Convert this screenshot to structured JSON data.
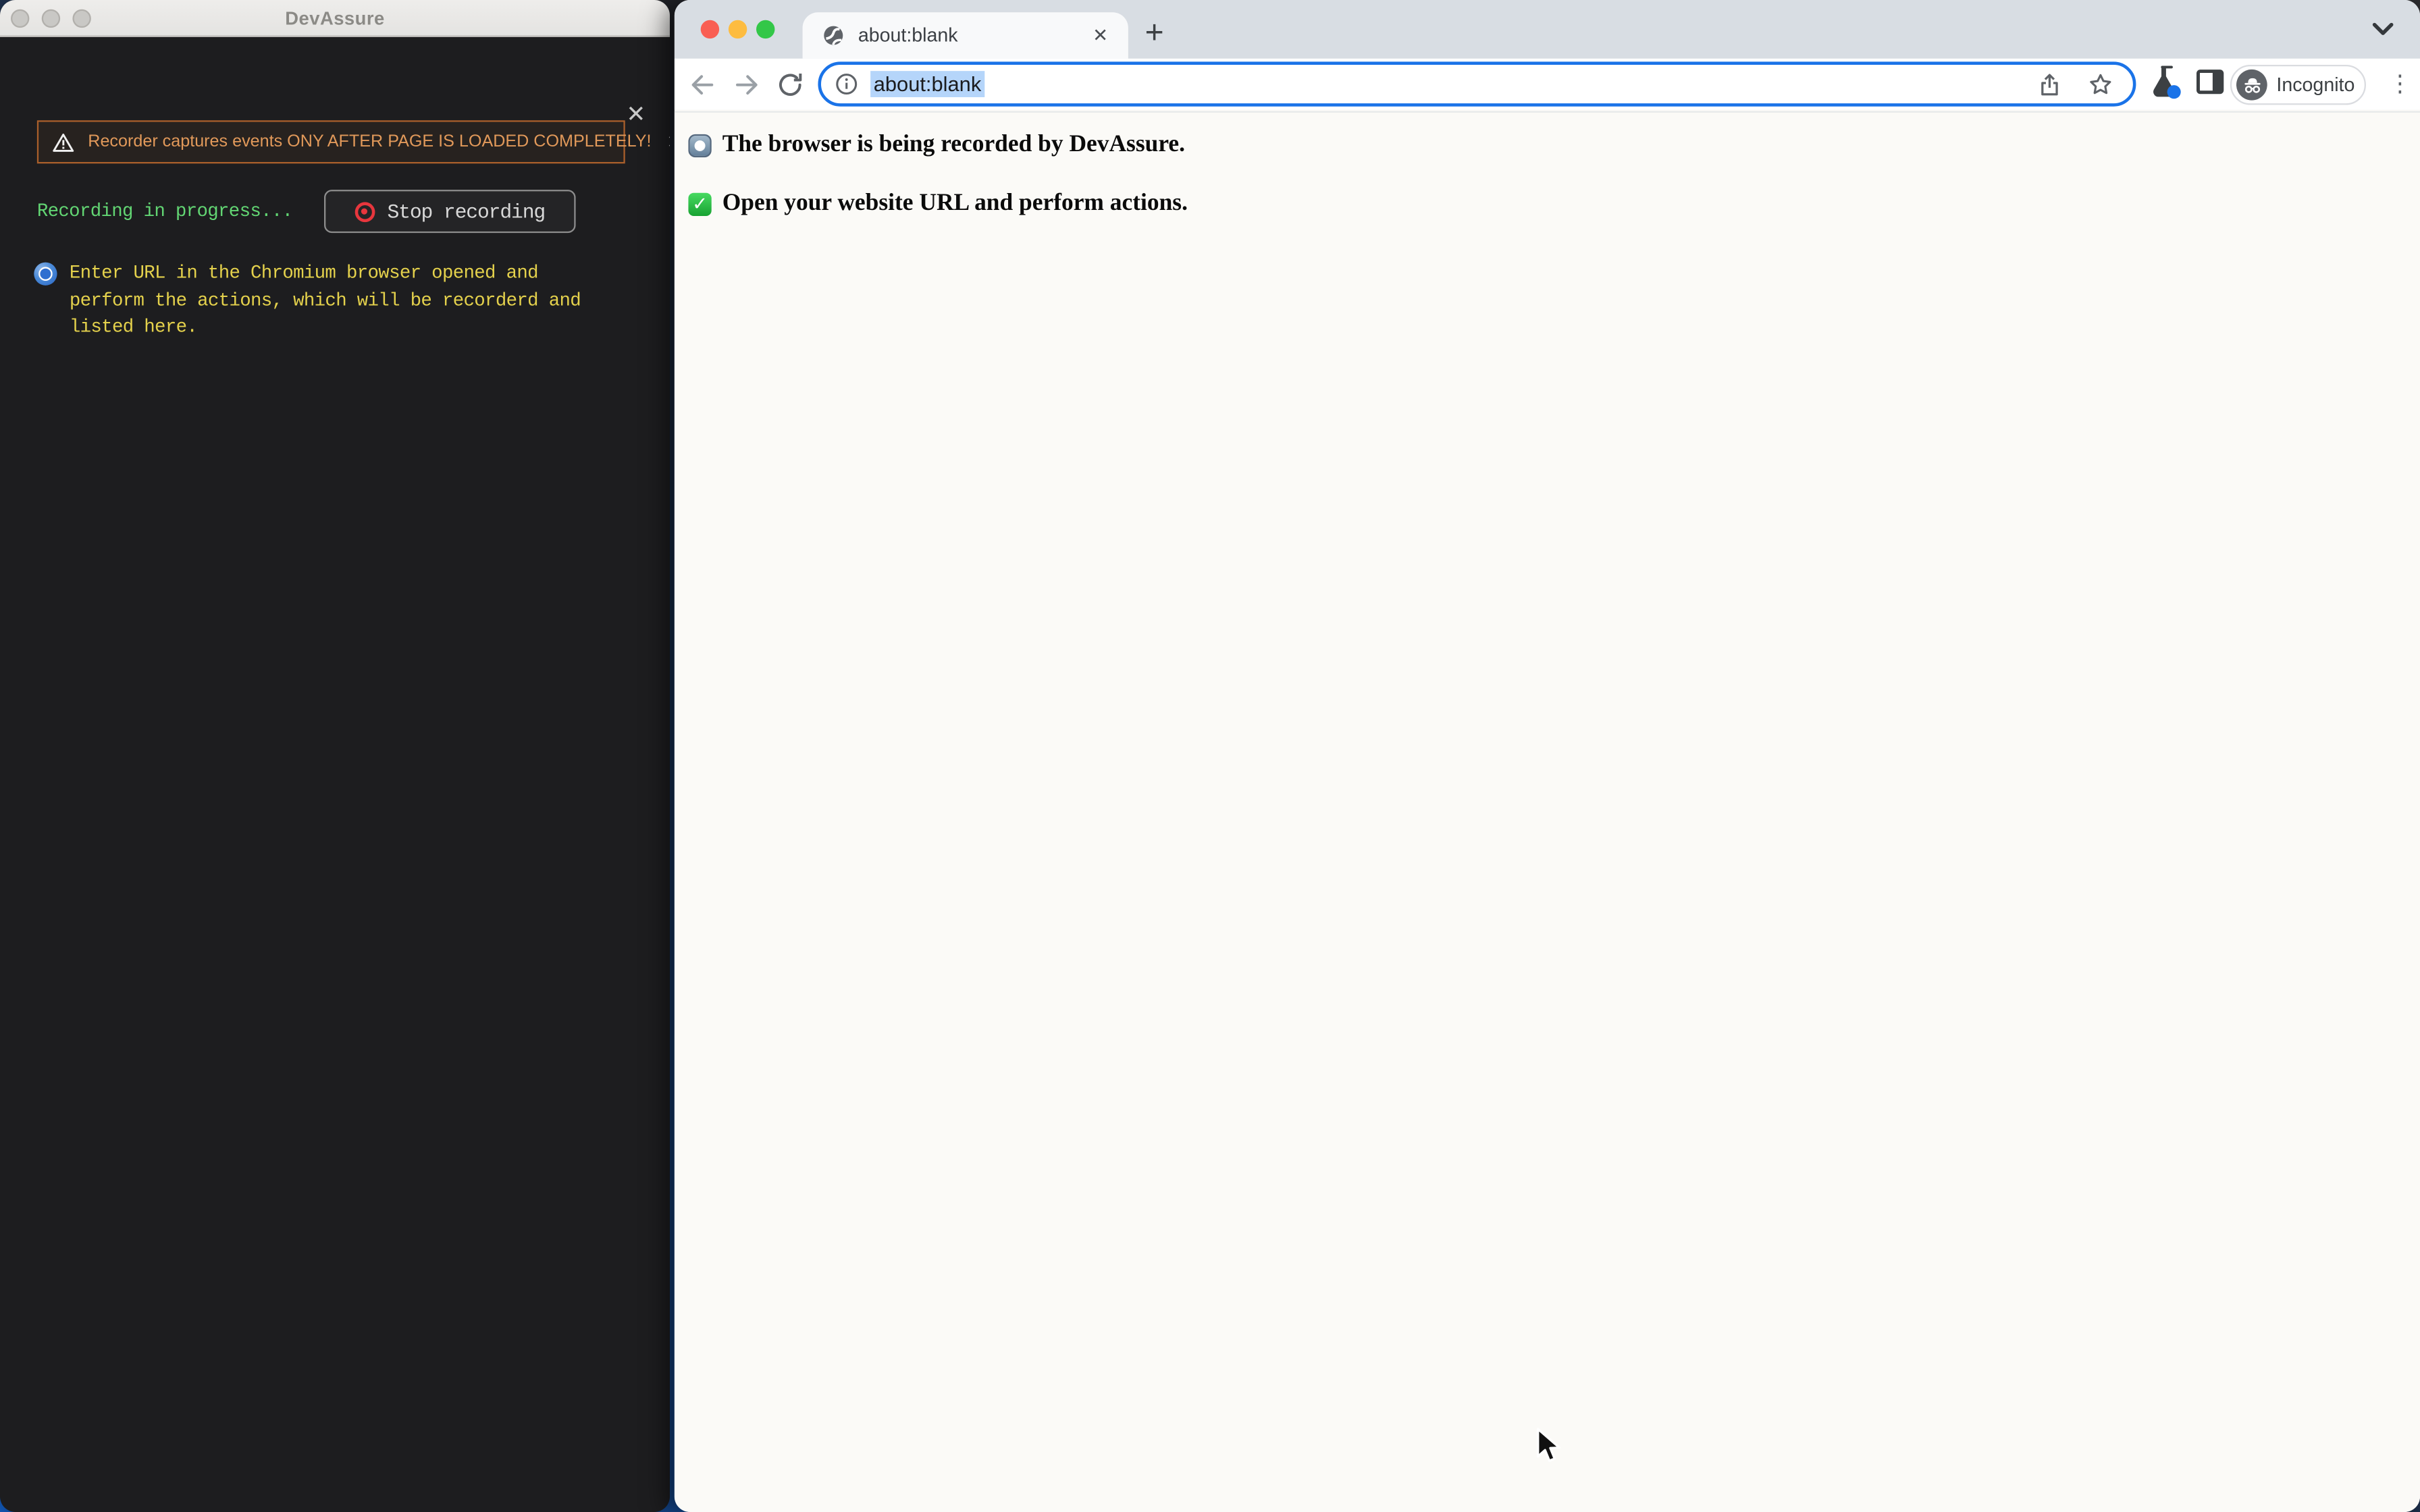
{
  "devassure": {
    "window_title": "DevAssure",
    "banner_text": "Recorder captures events ONY AFTER PAGE IS LOADED COMPLETELY!",
    "recording_status": "Recording in progress...",
    "stop_button_label": "Stop recording",
    "instruction": "Enter URL in the Chromium browser opened and perform the actions, which will be recorderd and listed here."
  },
  "browser": {
    "tab_title": "about:blank",
    "url_value": "about:blank",
    "incognito_label": "Incognito",
    "page_line1": "The browser is being recorded by DevAssure.",
    "page_line2": "Open your website URL and perform actions."
  },
  "icons": {
    "close": "✕",
    "new_tab": "+",
    "menu_dots": "⋮"
  },
  "colors": {
    "accent_blue": "#1a73e8",
    "warning_orange": "#e1995a",
    "recording_green": "#62d573",
    "instruction_yellow": "#e4d14c",
    "selection_blue": "#b5d5fa",
    "panel_dark": "#1d1d1f",
    "tabstrip_gray": "#d8dde3"
  }
}
